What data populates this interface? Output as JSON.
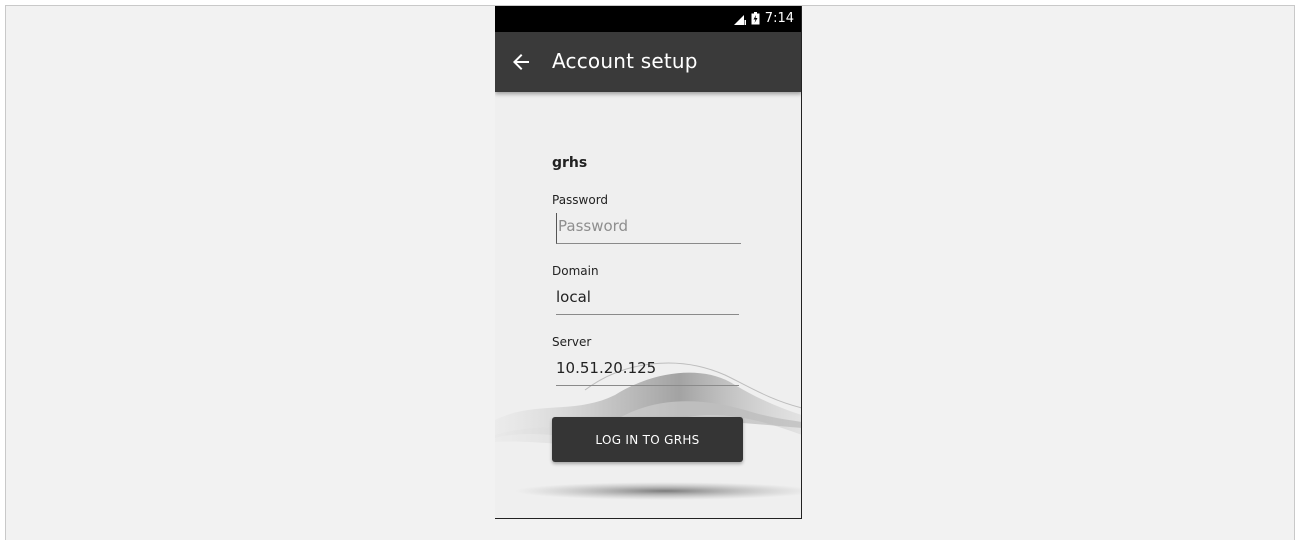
{
  "status_bar": {
    "time": "7:14",
    "icons": [
      "signal-icon",
      "battery-charging-icon"
    ]
  },
  "app_bar": {
    "title": "Account setup",
    "back_icon": "arrow-left-icon"
  },
  "form": {
    "account_name": "grhs",
    "password": {
      "label": "Password",
      "placeholder": "Password",
      "value": ""
    },
    "domain": {
      "label": "Domain",
      "value": "local"
    },
    "server": {
      "label": "Server",
      "value": "10.51.20.125"
    },
    "login_button": "LOG IN TO GRHS"
  },
  "colors": {
    "app_bar": "#3a3a3a",
    "status_bar": "#000000",
    "button": "#353535",
    "background": "#efefef",
    "outer_background": "#f2f2f2"
  }
}
